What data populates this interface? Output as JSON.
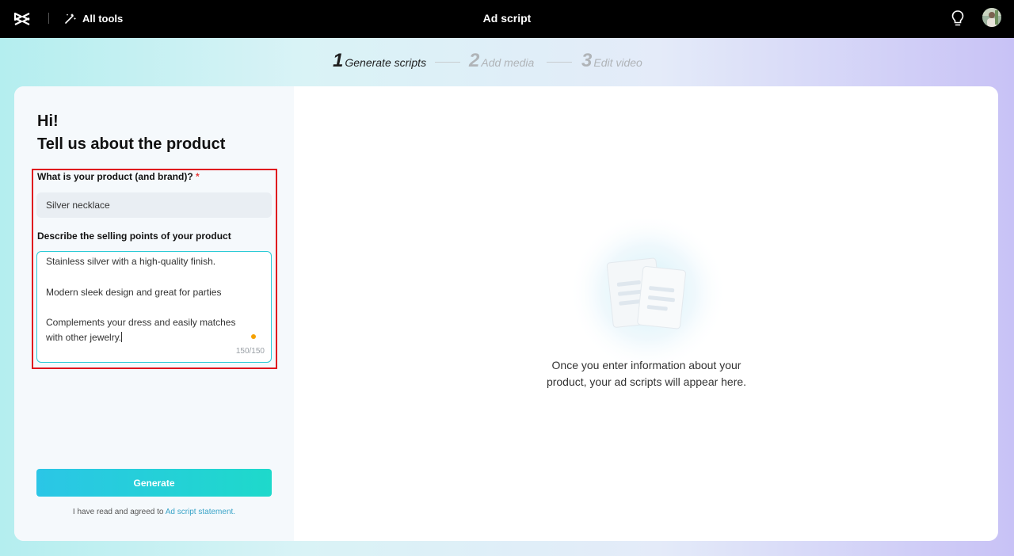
{
  "header": {
    "all_tools_label": "All tools",
    "title": "Ad script"
  },
  "steps": [
    {
      "number": "1",
      "label": "Generate scripts",
      "active": true
    },
    {
      "number": "2",
      "label": "Add media",
      "active": false
    },
    {
      "number": "3",
      "label": "Edit video",
      "active": false
    }
  ],
  "form": {
    "greeting_line1": "Hi!",
    "greeting_line2": "Tell us about the product",
    "product_label": "What is your product (and brand)?",
    "required_mark": "*",
    "product_value": "Silver necklace",
    "selling_label": "Describe the selling points of your product",
    "selling_lines": [
      "Stainless silver with a high-quality finish.",
      "Modern sleek design and great for parties",
      "Complements your dress and easily matches",
      "with other jewelry."
    ],
    "char_count": "150/150",
    "generate_label": "Generate",
    "agree_text": "I have read and agreed to ",
    "agree_link": "Ad script statement."
  },
  "empty_state": {
    "line1": "Once you enter information about your",
    "line2": "product, your ad scripts will appear here."
  },
  "colors": {
    "accent": "#2ccbd6",
    "highlight": "#e0141e",
    "status_dot": "#f5a100",
    "topbar": "#000000"
  },
  "icons": [
    "capcut-logo-icon",
    "magic-wand-icon",
    "lightbulb-icon",
    "avatar",
    "document-illustration"
  ]
}
